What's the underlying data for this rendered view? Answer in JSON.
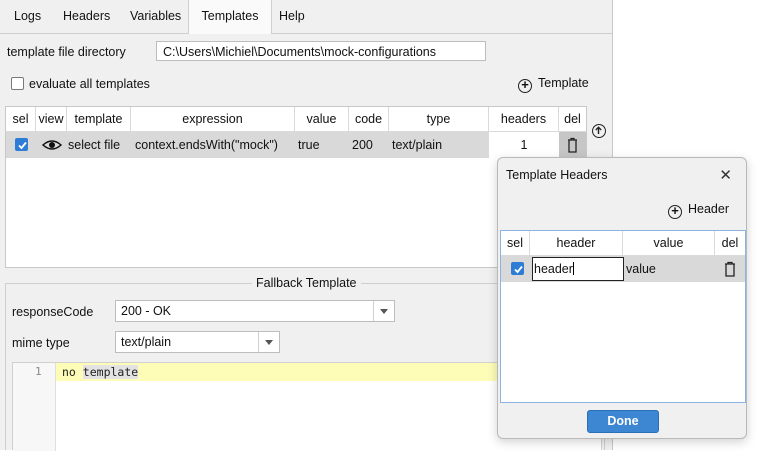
{
  "tabs": [
    {
      "label": "Logs"
    },
    {
      "label": "Headers"
    },
    {
      "label": "Variables"
    },
    {
      "label": "Templates",
      "active": true
    },
    {
      "label": "Help"
    }
  ],
  "templates": {
    "dir_label": "template file directory",
    "dir_value": "C:\\Users\\Michiel\\Documents\\mock-configurations",
    "evaluate_label": "evaluate all templates",
    "evaluate_checked": false,
    "add_label": "Template",
    "columns": [
      "sel",
      "view",
      "template",
      "expression",
      "value",
      "code",
      "type",
      "headers",
      "del"
    ],
    "rows": [
      {
        "sel": true,
        "template": "select file",
        "expression": "context.endsWith(\"mock\")",
        "value": "true",
        "code": "200",
        "type": "text/plain",
        "headers": "1"
      }
    ]
  },
  "fallback": {
    "title": "Fallback Template",
    "response_code_label": "responseCode",
    "response_code_value": "200 - OK",
    "mime_label": "mime type",
    "mime_value": "text/plain",
    "line_number": "1",
    "code_word1": "no",
    "code_word2": "template"
  },
  "dialog": {
    "title": "Template Headers",
    "close": "✕",
    "add_label": "Header",
    "columns": [
      "sel",
      "header",
      "value",
      "del"
    ],
    "rows": [
      {
        "sel": true,
        "header": "header",
        "value": "value"
      }
    ],
    "done_label": "Done"
  },
  "colors": {
    "accent": "#2d7cd6",
    "done_button": "#3c86d2",
    "code_highlight": "#fdfdb8",
    "selected_row": "#d9d9d9"
  }
}
